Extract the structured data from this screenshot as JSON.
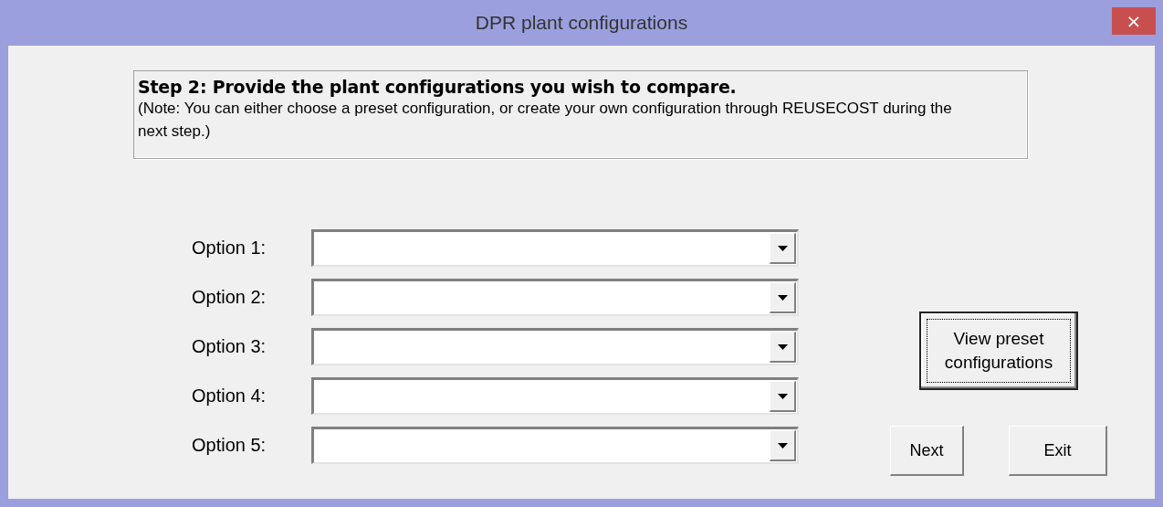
{
  "window": {
    "title": "DPR plant configurations",
    "close": "×"
  },
  "instruction": {
    "heading": "Step 2: Provide the plant configurations you wish to compare.",
    "note": "(Note: You can either choose a preset configuration, or create your own configuration through REUSECOST during the next step.)"
  },
  "options": [
    {
      "label": "Option 1:"
    },
    {
      "label": "Option 2:"
    },
    {
      "label": "Option 3:"
    },
    {
      "label": "Option 4:"
    },
    {
      "label": "Option 5:"
    }
  ],
  "preset_button": {
    "label": "View preset configurations",
    "focused": true
  },
  "buttons": [
    {
      "label": "Next"
    },
    {
      "label": "Exit"
    }
  ]
}
